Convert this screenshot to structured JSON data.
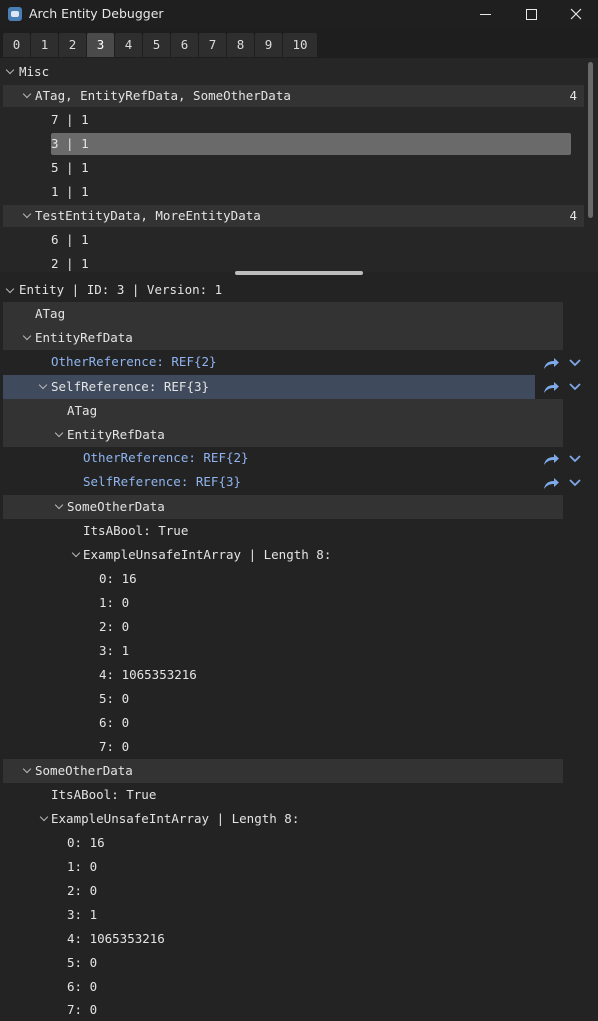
{
  "window": {
    "title": "Arch Entity Debugger"
  },
  "tabs": [
    "0",
    "1",
    "2",
    "3",
    "4",
    "5",
    "6",
    "7",
    "8",
    "9",
    "10"
  ],
  "active_tab": "3",
  "tree": {
    "root_label": "Misc",
    "groups": [
      {
        "label": "ATag, EntityRefData, SomeOtherData",
        "count": "4",
        "items": [
          "7 | 1",
          "3 | 1",
          "5 | 1",
          "1 | 1"
        ],
        "selected": "3 | 1"
      },
      {
        "label": "TestEntityData, MoreEntityData",
        "count": "4",
        "items": [
          "6 | 1",
          "2 | 1"
        ]
      }
    ]
  },
  "inspector": {
    "header": "Entity | ID: 3 | Version: 1",
    "atag": "ATag",
    "entity_ref_data": "EntityRefData",
    "other_reference": "OtherReference: REF{2}",
    "self_reference": "SelfReference: REF{3}",
    "nested": {
      "atag": "ATag",
      "entity_ref_data": "EntityRefData",
      "other_reference": "OtherReference: REF{2}",
      "self_reference": "SelfReference: REF{3}",
      "some_other_data": "SomeOtherData",
      "its_a_bool": "ItsABool: True",
      "array_label": "ExampleUnsafeIntArray | Length 8:",
      "array": [
        "0: 16",
        "1: 0",
        "2: 0",
        "3: 1",
        "4: 1065353216",
        "5: 0",
        "6: 0",
        "7: 0"
      ]
    },
    "some_other_data": "SomeOtherData",
    "its_a_bool": "ItsABool: True",
    "array_label": "ExampleUnsafeIntArray | Length 8:",
    "array": [
      "0: 16",
      "1: 0",
      "2: 0",
      "3: 1",
      "4: 1065353216",
      "5: 0",
      "6: 0",
      "7: 0"
    ]
  },
  "colors": {
    "background": "#232323",
    "header_band": "#333333",
    "selected_band": "#3f4a5c",
    "reference_text": "#8fb4f0",
    "action_icon": "#7fa9ea"
  },
  "icons": [
    "godot-icon",
    "minimize-icon",
    "maximize-icon",
    "close-icon",
    "chevron-down-icon",
    "chevron-right-icon",
    "jump-arrow-icon"
  ]
}
